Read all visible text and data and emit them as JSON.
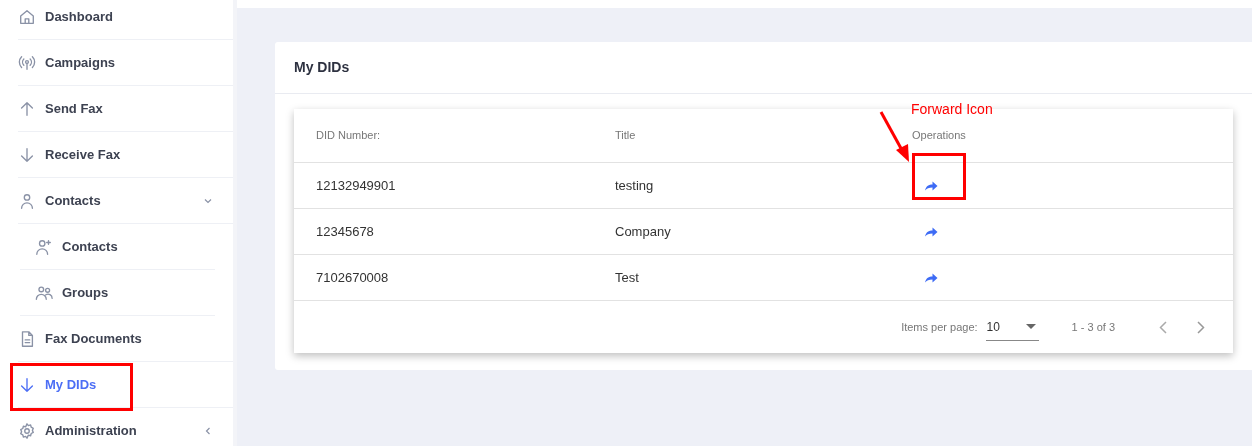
{
  "sidebar": {
    "items": [
      {
        "label": "Dashboard",
        "selected": false,
        "highlighted": false
      },
      {
        "label": "Campaigns",
        "selected": false,
        "highlighted": false
      },
      {
        "label": "Send Fax",
        "selected": false,
        "highlighted": false
      },
      {
        "label": "Receive Fax",
        "selected": false,
        "highlighted": false
      },
      {
        "label": "Contacts",
        "selected": false,
        "highlighted": false,
        "expanded": true,
        "children": [
          {
            "label": "Contacts",
            "selected": false
          },
          {
            "label": "Groups",
            "selected": false
          }
        ]
      },
      {
        "label": "Fax Documents",
        "selected": false,
        "highlighted": false
      },
      {
        "label": "My DIDs",
        "selected": true,
        "highlighted": true
      },
      {
        "label": "Administration",
        "selected": false,
        "highlighted": false,
        "expanded": false
      }
    ]
  },
  "card": {
    "title": "My DIDs",
    "table": {
      "columns": [
        "DID Number:",
        "Title",
        "Operations"
      ],
      "rows": [
        {
          "did": "12132949901",
          "title": "testing",
          "highlighted": true
        },
        {
          "did": "12345678",
          "title": "Company",
          "highlighted": false
        },
        {
          "did": "7102670008",
          "title": "Test",
          "highlighted": false
        }
      ],
      "annotation": "Forward Icon",
      "paginator": {
        "label": "Items per page:",
        "page_size": "10",
        "range": "1 - 3 of 3"
      }
    }
  }
}
